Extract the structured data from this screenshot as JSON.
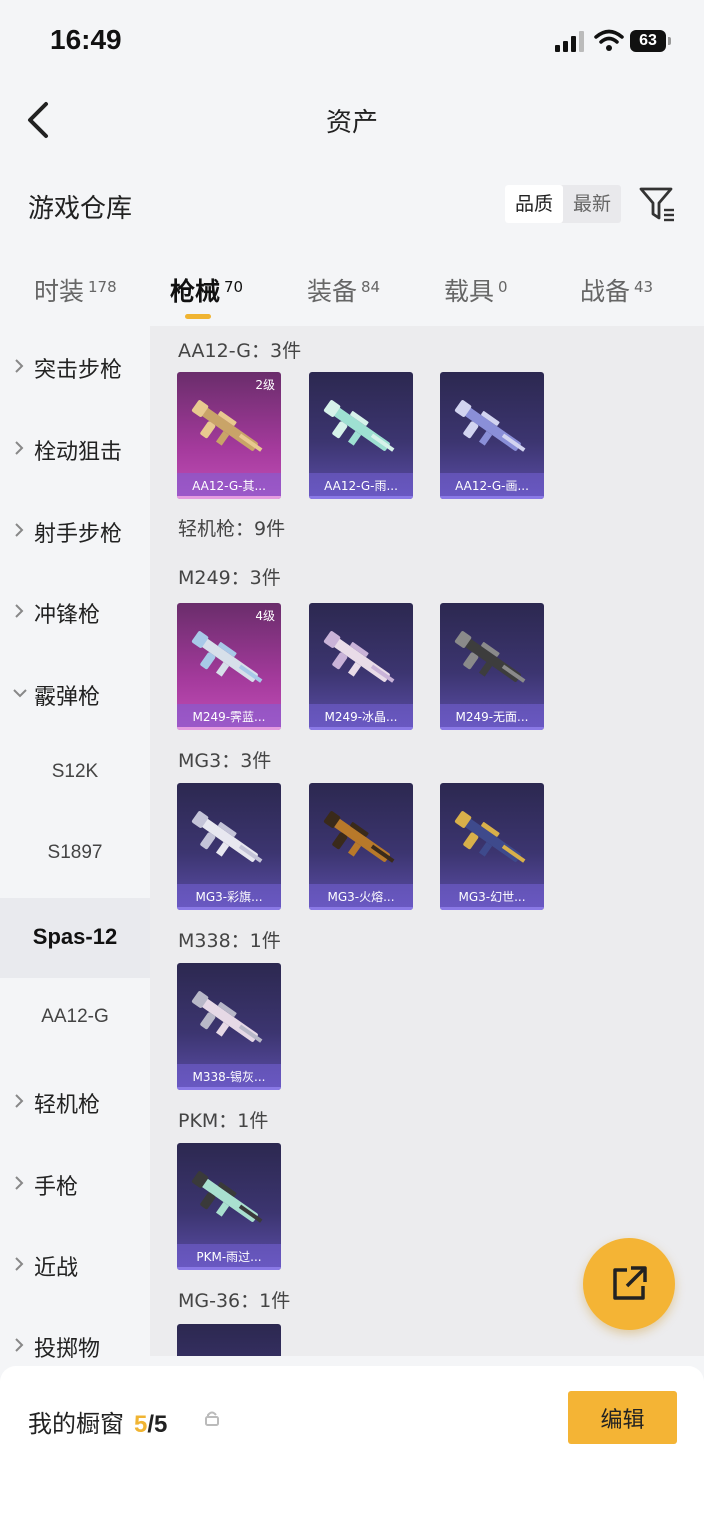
{
  "status_bar": {
    "time": "16:49",
    "battery": "63"
  },
  "navbar": {
    "title": "资产"
  },
  "header": {
    "title": "游戏仓库",
    "sort_options": [
      "品质",
      "最新"
    ],
    "sort_selected": "品质"
  },
  "tabs": [
    {
      "label": "时装",
      "count": "178"
    },
    {
      "label": "枪械",
      "count": "70",
      "active": true
    },
    {
      "label": "装备",
      "count": "84"
    },
    {
      "label": "载具",
      "count": "0"
    },
    {
      "label": "战备",
      "count": "43"
    }
  ],
  "sidebar": {
    "items": [
      {
        "label": "突击步枪"
      },
      {
        "label": "栓动狙击"
      },
      {
        "label": "射手步枪"
      },
      {
        "label": "冲锋枪"
      },
      {
        "label": "霰弹枪",
        "expanded": true
      },
      {
        "label": "S12K"
      },
      {
        "label": "S1897"
      },
      {
        "label": "Spas-12",
        "active": true
      },
      {
        "label": "AA12-G"
      },
      {
        "label": "轻机枪"
      },
      {
        "label": "手枪"
      },
      {
        "label": "近战"
      },
      {
        "label": "投掷物"
      }
    ]
  },
  "content": {
    "groups": [
      {
        "title": "AA12-G：3件",
        "cards": [
          {
            "name": "AA12-G-其...",
            "level": "2级",
            "rarity": "gold"
          },
          {
            "name": "AA12-G-雨...",
            "rarity": "purple"
          },
          {
            "name": "AA12-G-画...",
            "rarity": "purple"
          }
        ]
      },
      {
        "title": "轻机枪：9件",
        "cards": []
      },
      {
        "title": "M249：3件",
        "cards": [
          {
            "name": "M249-霁蓝...",
            "level": "4级",
            "rarity": "gold"
          },
          {
            "name": "M249-冰晶...",
            "rarity": "purple"
          },
          {
            "name": "M249-无面...",
            "rarity": "purple"
          }
        ]
      },
      {
        "title": "MG3：3件",
        "cards": [
          {
            "name": "MG3-彩旗...",
            "rarity": "purple"
          },
          {
            "name": "MG3-火熔...",
            "rarity": "purple"
          },
          {
            "name": "MG3-幻世...",
            "rarity": "purple"
          }
        ]
      },
      {
        "title": "M338：1件",
        "cards": [
          {
            "name": "M338-锡灰...",
            "rarity": "purple"
          }
        ]
      },
      {
        "title": "PKM：1件",
        "cards": [
          {
            "name": "PKM-雨过...",
            "rarity": "purple"
          }
        ]
      },
      {
        "title": "MG-36：1件",
        "cards": []
      }
    ]
  },
  "bottom_bar": {
    "label": "我的橱窗",
    "current": "5",
    "total": "/5",
    "edit_label": "编辑"
  },
  "colors": {
    "accent": "#f4b435",
    "purple_card": "#3c3570",
    "gold_card": "#a43a9c"
  }
}
